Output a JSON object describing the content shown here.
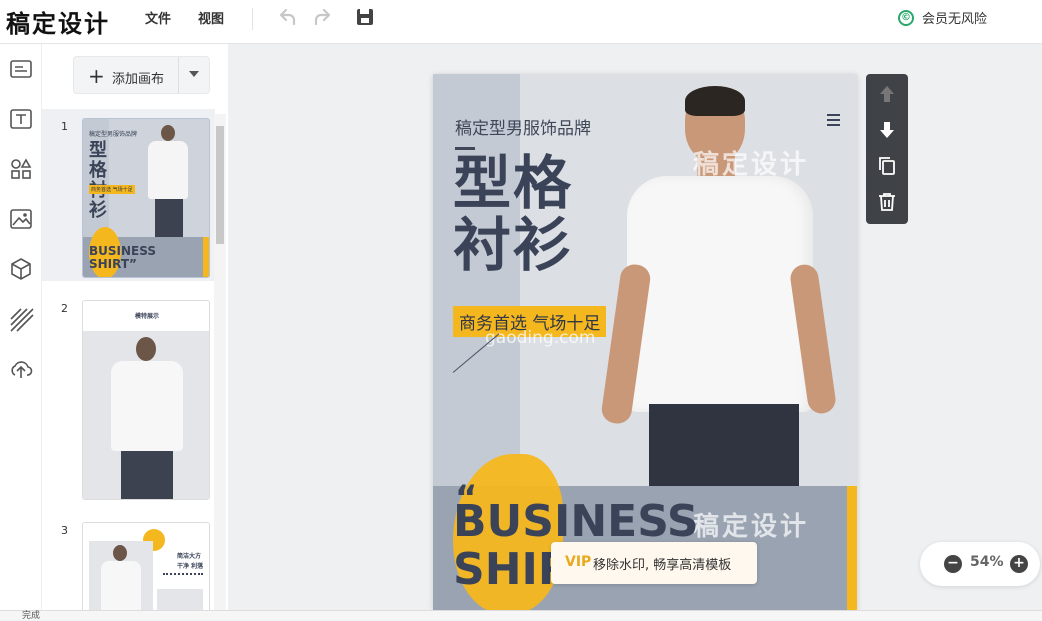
{
  "app": {
    "title": "稿定设计"
  },
  "menu": {
    "file": "文件",
    "view": "视图"
  },
  "vip": {
    "label": "会员无风险",
    "icon": "©"
  },
  "sidebar": {
    "add_canvas_label": "添加画布",
    "pages": [
      {
        "number": "1",
        "title_text": "型格衬衫",
        "english": "BUSINESS SHIRT”",
        "brand": "稿定型男服饰品牌",
        "tag": "商务首选 气场十足"
      },
      {
        "number": "2",
        "title_text": "模特展示"
      },
      {
        "number": "3",
        "line1": "简洁大方",
        "line2": "干净 利落"
      }
    ]
  },
  "poster": {
    "brand": "稿定型男服饰品牌",
    "title_line1": "型格",
    "title_line2": "衬衫",
    "tag": "商务首选 气场十足",
    "quote_mark": "“",
    "english_line1": "BUSINESS",
    "english_line2": "SHIR",
    "watermark_cn": "稿定设计",
    "watermark_url": "gaoding.com",
    "remove_watermark": "移除水印, 畅享高清模板",
    "vip_mark": "VIP"
  },
  "zoom": {
    "value": "54%"
  },
  "status": {
    "text": "完成"
  },
  "colors": {
    "accent_yellow": "#f5b71e",
    "navy": "#3a4358",
    "vip_green": "#2aa86a"
  }
}
